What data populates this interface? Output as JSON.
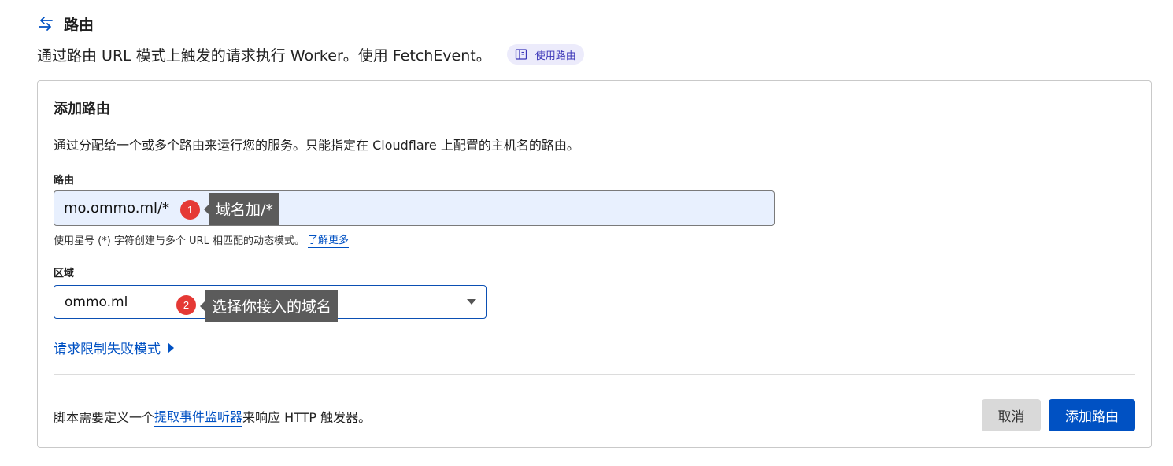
{
  "header": {
    "title": "路由",
    "description": "通过路由 URL 模式上触发的请求执行 Worker。使用 FetchEvent。",
    "doc_pill_label": "使用路由"
  },
  "card": {
    "title": "添加路由",
    "description": "通过分配给一个或多个路由来运行您的服务。只能指定在 Cloudflare 上配置的主机名的路由。",
    "route": {
      "label": "路由",
      "value": "mo.ommo.ml/*",
      "hint": "使用星号 (*) 字符创建与多个 URL 相匹配的动态模式。",
      "hint_link": "了解更多"
    },
    "zone": {
      "label": "区域",
      "selected": "ommo.ml"
    },
    "rate_limit_link": "请求限制失败模式",
    "footer": {
      "prefix": "脚本需要定义一个",
      "link": "提取事件监听器",
      "suffix": "来响应 HTTP 触发器。"
    },
    "buttons": {
      "cancel": "取消",
      "add": "添加路由"
    }
  },
  "annotations": [
    {
      "number": "1",
      "text": "域名加/*"
    },
    {
      "number": "2",
      "text": "选择你接入的域名"
    }
  ],
  "colors": {
    "accent": "#0051c3",
    "input_autofill_bg": "#e8f0fe",
    "annotation_badge": "#e53935",
    "annotation_tip": "#5b5b5b"
  },
  "icons": [
    "arrows-left-right-icon",
    "book-icon",
    "chevron-down-icon",
    "caret-right-icon"
  ]
}
